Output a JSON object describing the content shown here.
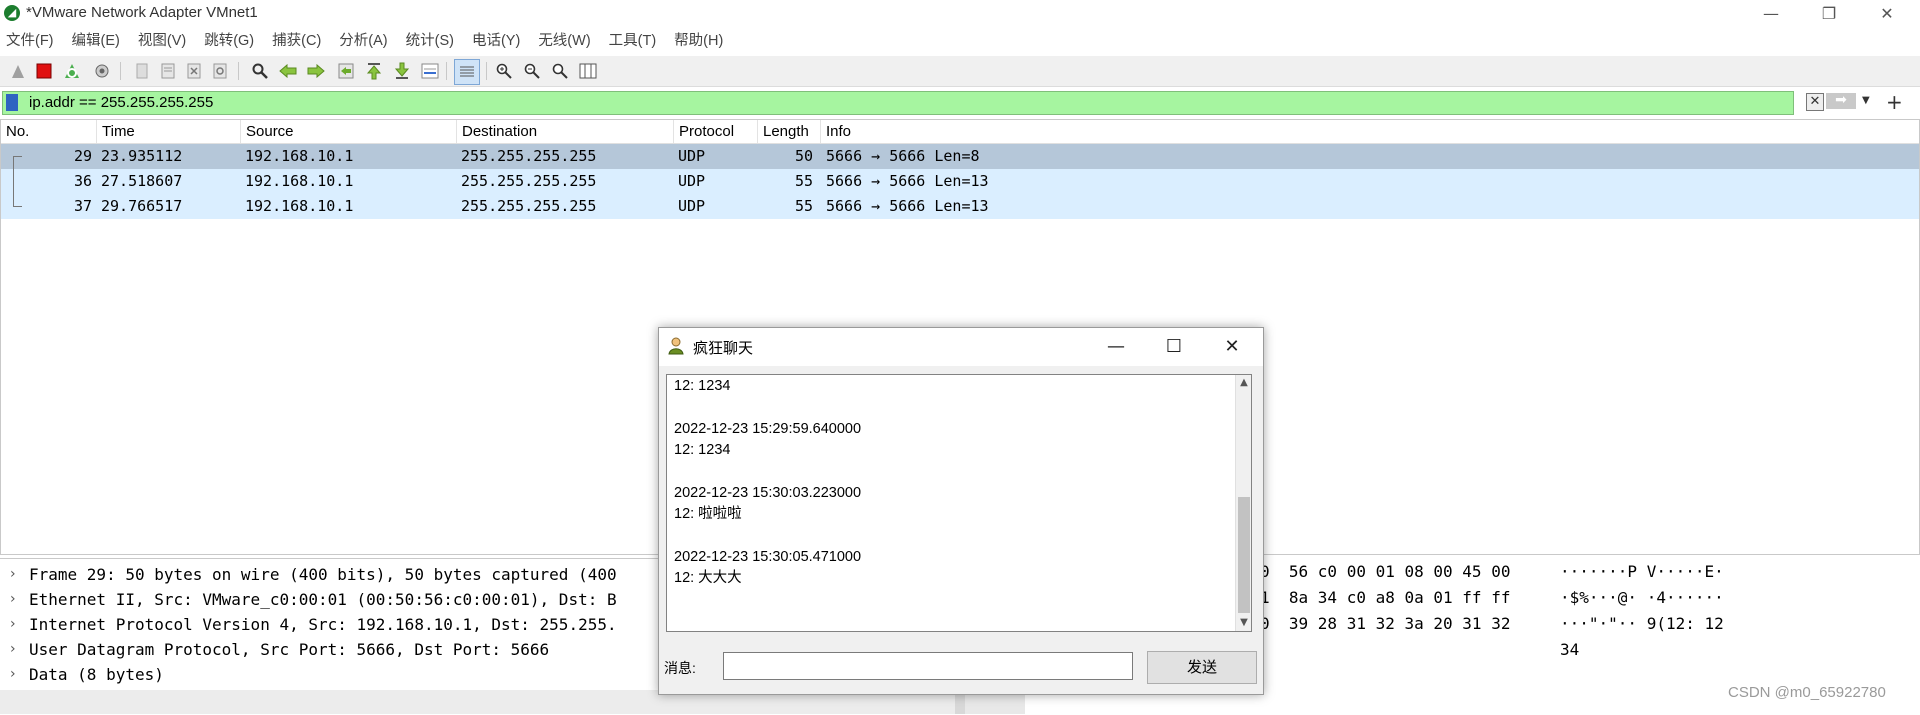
{
  "window": {
    "title": "*VMware Network Adapter VMnet1",
    "app_icon": "wireshark-fin-icon",
    "controls": {
      "minimize": "—",
      "restore": "❐",
      "close": "✕"
    }
  },
  "menu": [
    "文件(F)",
    "编辑(E)",
    "视图(V)",
    "跳转(G)",
    "捕获(C)",
    "分析(A)",
    "统计(S)",
    "电话(Y)",
    "无线(W)",
    "工具(T)",
    "帮助(H)"
  ],
  "toolbar": {
    "icons": [
      "start-capture-icon",
      "stop-capture-icon",
      "restart-capture-icon",
      "capture-options-icon",
      "open-file-icon",
      "save-file-icon",
      "close-file-icon",
      "reload-file-icon",
      "find-packet-icon",
      "go-back-icon",
      "go-forward-icon",
      "go-to-packet-icon",
      "first-packet-icon",
      "last-packet-icon",
      "autoscroll-icon",
      "colorize-icon",
      "zoom-in-icon",
      "zoom-out-icon",
      "normal-size-icon",
      "resize-columns-icon"
    ]
  },
  "filter": {
    "value": "ip.addr == 255.255.255.255",
    "bg_color": "#a6f5a0"
  },
  "packet_list": {
    "columns": [
      "No.",
      "Time",
      "Source",
      "Destination",
      "Protocol",
      "Length",
      "Info"
    ],
    "rows": [
      {
        "no": "29",
        "time": "23.935112",
        "source": "192.168.10.1",
        "destination": "255.255.255.255",
        "protocol": "UDP",
        "length": "50",
        "info": "5666 → 5666 Len=8",
        "selected": true
      },
      {
        "no": "36",
        "time": "27.518607",
        "source": "192.168.10.1",
        "destination": "255.255.255.255",
        "protocol": "UDP",
        "length": "55",
        "info": "5666 → 5666 Len=13",
        "selected": false
      },
      {
        "no": "37",
        "time": "29.766517",
        "source": "192.168.10.1",
        "destination": "255.255.255.255",
        "protocol": "UDP",
        "length": "55",
        "info": "5666 → 5666 Len=13",
        "selected": false
      }
    ],
    "selected_color": "#b5c7d9",
    "row_color": "#daeeff"
  },
  "details": [
    "Frame 29: 50 bytes on wire (400 bits), 50 bytes captured (400",
    "Ethernet II, Src: VMware_c0:00:01 (00:50:56:c0:00:01), Dst: B",
    "Internet Protocol Version 4, Src: 192.168.10.1, Dst: 255.255.",
    "User Datagram Protocol, Src Port: 5666, Dst Port: 5666",
    "Data (8 bytes)"
  ],
  "bytes": {
    "hex": [
      "0  56 c0 00 01 08 00 45 00",
      "1  8a 34 c0 a8 0a 01 ff ff",
      "0  39 28 31 32 3a 20 31 32"
    ],
    "ascii": [
      "·······P V·····E·",
      "·$%···@· ·4······",
      "···\"·\"·· 9(12: 12",
      "34"
    ]
  },
  "watermark": "CSDN @m0_65922780",
  "chat": {
    "title": "疯狂聊天",
    "controls": {
      "minimize": "—",
      "maximize": "☐",
      "close": "✕"
    },
    "lines": [
      "12: 1234",
      "",
      "2022-12-23 15:29:59.640000",
      "12: 1234",
      "",
      "2022-12-23 15:30:03.223000",
      "12: 啦啦啦",
      "",
      "2022-12-23 15:30:05.471000",
      "12: 大大大"
    ],
    "message_label": "消息:",
    "message_value": "",
    "send_label": "发送"
  }
}
